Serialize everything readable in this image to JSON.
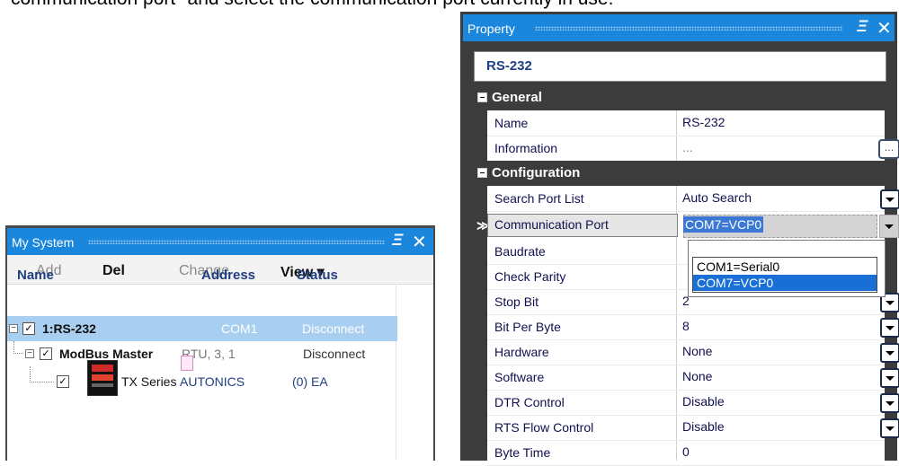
{
  "caption": "communication port\" and select the communication port currently in use.",
  "my_system": {
    "title": "My System",
    "toolbar": {
      "add": "Add",
      "del": "Del",
      "change": "Change",
      "view": "View ▾"
    },
    "columns": {
      "name": "Name",
      "address": "Address",
      "status": "Status"
    },
    "rows": [
      {
        "name": "1:RS-232",
        "address": "COM1",
        "status": "Disconnect"
      },
      {
        "name": "ModBus Master",
        "address": "RTU, 3, 1",
        "status": "Disconnect"
      },
      {
        "name": "TX Series",
        "address": "AUTONICS",
        "status": "(0) EA"
      }
    ]
  },
  "property": {
    "title": "Property",
    "object": "RS-232",
    "categories": {
      "general": "General",
      "configuration": "Configuration"
    },
    "general_rows": [
      {
        "name": "Name",
        "value": "RS-232"
      },
      {
        "name": "Information",
        "value": "..."
      }
    ],
    "config_rows": [
      {
        "name": "Search Port List",
        "value": "Auto Search"
      },
      {
        "name": "Communication Port",
        "value": "COM7=VCP0"
      },
      {
        "name": "Baudrate",
        "value": ""
      },
      {
        "name": "Check Parity",
        "value": ""
      },
      {
        "name": "Stop Bit",
        "value": "2"
      },
      {
        "name": "Bit Per Byte",
        "value": "8"
      },
      {
        "name": "Hardware",
        "value": "None"
      },
      {
        "name": "Software",
        "value": "None"
      },
      {
        "name": "DTR Control",
        "value": "Disable"
      },
      {
        "name": "RTS Flow Control",
        "value": "Disable"
      },
      {
        "name": "Byte Time",
        "value": "0"
      }
    ],
    "dropdown_options": [
      "COM1=Serial0",
      "COM7=VCP0"
    ],
    "dropdown_selected": "COM7=VCP0"
  },
  "icons": {
    "pin": "pin-icon",
    "close": "close-icon",
    "check": "✓",
    "ellipsis": "…",
    "row_marker": "≫"
  },
  "colors": {
    "titlebar": "#1a86dc",
    "selection": "#a8cff0",
    "dropdown_highlight": "#1a6fd6"
  }
}
